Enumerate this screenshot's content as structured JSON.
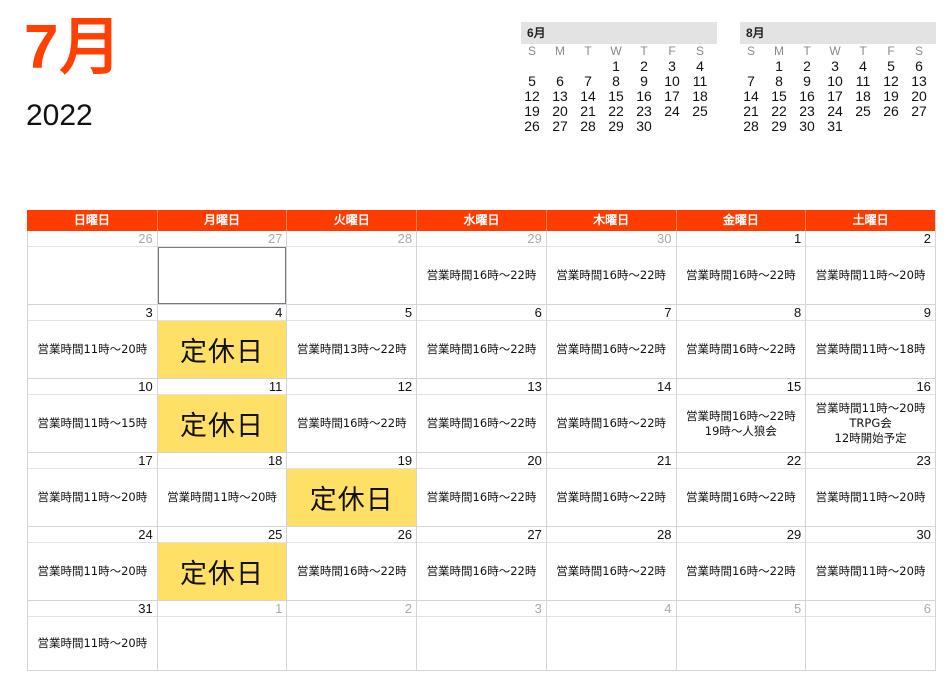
{
  "title": {
    "month": "7月",
    "year": "2022"
  },
  "mini_calendars": [
    {
      "name": "6月",
      "dows": [
        "S",
        "M",
        "T",
        "W",
        "T",
        "F",
        "S"
      ],
      "weeks": [
        [
          "",
          "",
          "",
          "1",
          "2",
          "3",
          "4"
        ],
        [
          "5",
          "6",
          "7",
          "8",
          "9",
          "10",
          "11"
        ],
        [
          "12",
          "13",
          "14",
          "15",
          "16",
          "17",
          "18"
        ],
        [
          "19",
          "20",
          "21",
          "22",
          "23",
          "24",
          "25"
        ],
        [
          "26",
          "27",
          "28",
          "29",
          "30",
          "",
          ""
        ]
      ]
    },
    {
      "name": "8月",
      "dows": [
        "S",
        "M",
        "T",
        "W",
        "T",
        "F",
        "S"
      ],
      "weeks": [
        [
          "",
          "1",
          "2",
          "3",
          "4",
          "5",
          "6"
        ],
        [
          "7",
          "8",
          "9",
          "10",
          "11",
          "12",
          "13"
        ],
        [
          "14",
          "15",
          "16",
          "17",
          "18",
          "19",
          "20"
        ],
        [
          "21",
          "22",
          "23",
          "24",
          "25",
          "26",
          "27"
        ],
        [
          "28",
          "29",
          "30",
          "31",
          "",
          "",
          ""
        ]
      ]
    }
  ],
  "weekdays": [
    "日曜日",
    "月曜日",
    "火曜日",
    "水曜日",
    "木曜日",
    "金曜日",
    "土曜日"
  ],
  "weeks": [
    [
      {
        "num": "26",
        "other": true,
        "events": []
      },
      {
        "num": "27",
        "other": true,
        "events": [],
        "selected": true
      },
      {
        "num": "28",
        "other": true,
        "events": []
      },
      {
        "num": "29",
        "other": true,
        "events": [
          "営業時間16時〜22時"
        ]
      },
      {
        "num": "30",
        "other": true,
        "events": [
          "営業時間16時〜22時"
        ]
      },
      {
        "num": "1",
        "events": [
          "営業時間16時〜22時"
        ]
      },
      {
        "num": "2",
        "events": [
          "営業時間11時〜20時"
        ]
      }
    ],
    [
      {
        "num": "3",
        "events": [
          "営業時間11時〜20時"
        ]
      },
      {
        "num": "4",
        "closed": "定休日",
        "events": []
      },
      {
        "num": "5",
        "events": [
          "営業時間13時〜22時"
        ]
      },
      {
        "num": "6",
        "events": [
          "営業時間16時〜22時"
        ]
      },
      {
        "num": "7",
        "events": [
          "営業時間16時〜22時"
        ]
      },
      {
        "num": "8",
        "events": [
          "営業時間16時〜22時"
        ]
      },
      {
        "num": "9",
        "events": [
          "営業時間11時〜18時"
        ]
      }
    ],
    [
      {
        "num": "10",
        "events": [
          "営業時間11時〜15時"
        ]
      },
      {
        "num": "11",
        "closed": "定休日",
        "events": []
      },
      {
        "num": "12",
        "events": [
          "営業時間16時〜22時"
        ]
      },
      {
        "num": "13",
        "events": [
          "営業時間16時〜22時"
        ]
      },
      {
        "num": "14",
        "events": [
          "営業時間16時〜22時"
        ]
      },
      {
        "num": "15",
        "events": [
          "営業時間16時〜22時",
          "19時〜人狼会"
        ]
      },
      {
        "num": "16",
        "events": [
          "営業時間11時〜20時",
          "TRPG会",
          "12時開始予定"
        ]
      }
    ],
    [
      {
        "num": "17",
        "events": [
          "営業時間11時〜20時"
        ]
      },
      {
        "num": "18",
        "events": [
          "営業時間11時〜20時"
        ]
      },
      {
        "num": "19",
        "closed": "定休日",
        "events": []
      },
      {
        "num": "20",
        "events": [
          "営業時間16時〜22時"
        ]
      },
      {
        "num": "21",
        "events": [
          "営業時間16時〜22時"
        ]
      },
      {
        "num": "22",
        "events": [
          "営業時間16時〜22時"
        ]
      },
      {
        "num": "23",
        "events": [
          "営業時間11時〜20時"
        ]
      }
    ],
    [
      {
        "num": "24",
        "events": [
          "営業時間11時〜20時"
        ]
      },
      {
        "num": "25",
        "closed": "定休日",
        "events": []
      },
      {
        "num": "26",
        "events": [
          "営業時間16時〜22時"
        ]
      },
      {
        "num": "27",
        "events": [
          "営業時間16時〜22時"
        ]
      },
      {
        "num": "28",
        "events": [
          "営業時間16時〜22時"
        ]
      },
      {
        "num": "29",
        "events": [
          "営業時間16時〜22時"
        ]
      },
      {
        "num": "30",
        "events": [
          "営業時間11時〜20時"
        ]
      }
    ],
    [
      {
        "num": "31",
        "events": [
          "営業時間11時〜20時"
        ]
      },
      {
        "num": "1",
        "other": true,
        "events": []
      },
      {
        "num": "2",
        "other": true,
        "events": []
      },
      {
        "num": "3",
        "other": true,
        "events": []
      },
      {
        "num": "4",
        "other": true,
        "events": []
      },
      {
        "num": "5",
        "other": true,
        "events": []
      },
      {
        "num": "6",
        "other": true,
        "events": []
      }
    ]
  ],
  "colors": {
    "accent": "#ff4000",
    "header_bar": "#ff3c00",
    "closed_highlight": "#ffe066"
  }
}
